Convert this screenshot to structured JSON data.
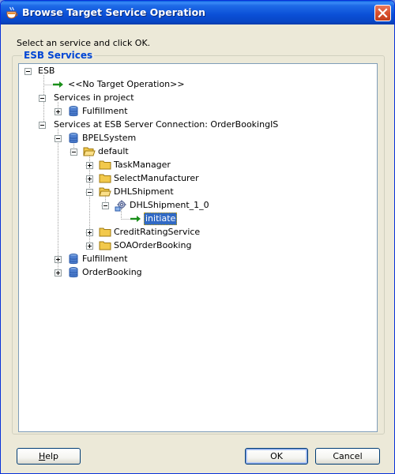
{
  "window": {
    "title": "Browse Target Service Operation",
    "close_label": "×"
  },
  "instruction": "Select an service and click OK.",
  "group": {
    "legend": "ESB Services"
  },
  "tree": {
    "root": "ESB",
    "no_target": "<<No Target Operation>>",
    "services_in_project": "Services in project",
    "project_fulfillment": "Fulfillment",
    "server_connection": "Services at ESB Server Connection: OrderBookingIS",
    "bpel_system": "BPELSystem",
    "default_folder": "default",
    "task_manager": "TaskManager",
    "select_manufacturer": "SelectManufacturer",
    "dhl_shipment": "DHLShipment",
    "dhl_shipment_version": "DHLShipment_1_0",
    "initiate": "initiate",
    "credit_rating": "CreditRatingService",
    "soa_order_booking": "SOAOrderBooking",
    "server_fulfillment": "Fulfillment",
    "order_booking": "OrderBooking"
  },
  "buttons": {
    "help_prefix": "",
    "help_mnemonic": "H",
    "help_rest": "elp",
    "ok": "OK",
    "cancel": "Cancel"
  },
  "colors": {
    "accent": "#0046d5",
    "selection": "#316ac5",
    "title_bar": "#0a4fd6"
  }
}
